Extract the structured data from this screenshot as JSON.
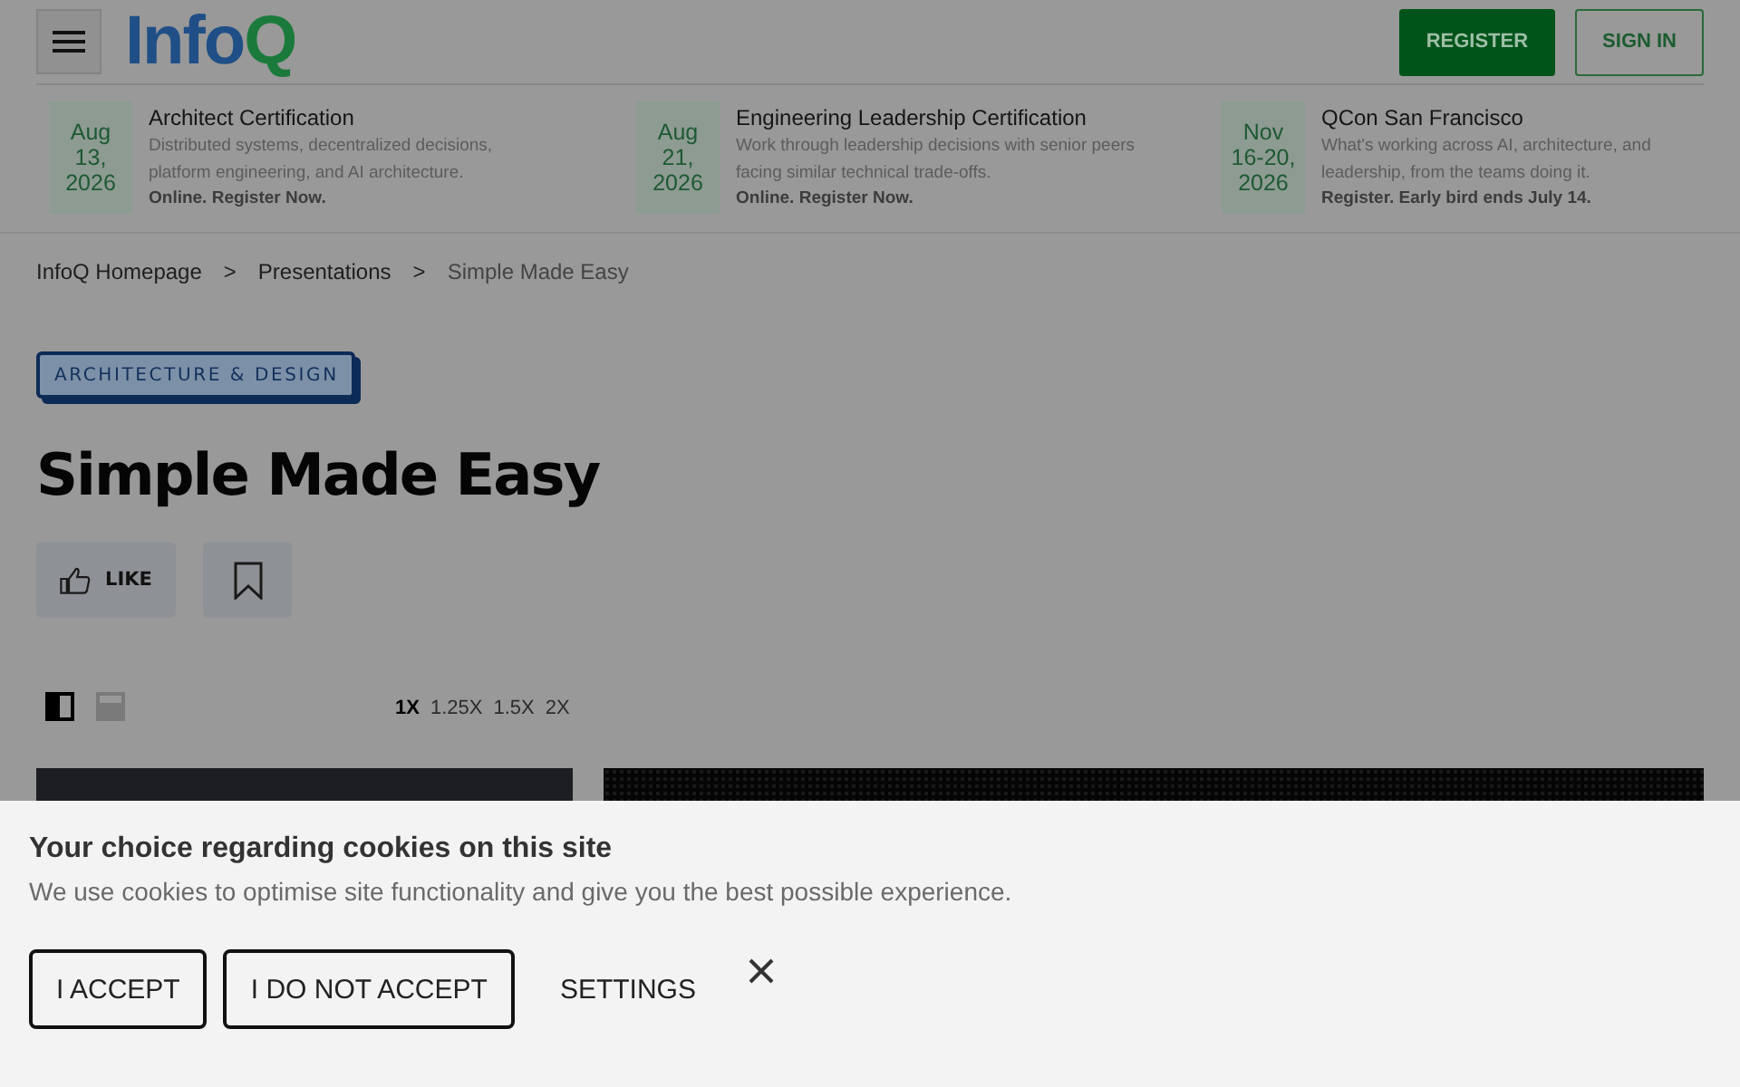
{
  "header": {
    "logo": [
      {
        "text": "Info",
        "color": "#1f4f86"
      },
      {
        "text": "Q",
        "color": "#1b7a3b"
      }
    ],
    "buttons": [
      {
        "label": "REGISTER",
        "kind": "primary"
      },
      {
        "label": "SIGN IN",
        "kind": "outline"
      }
    ]
  },
  "events": [
    {
      "date": [
        "Aug",
        "13,",
        "2026"
      ],
      "title": "Architect Certification",
      "description": "Distributed systems, decentralized decisions, platform engineering, and AI architecture.",
      "cta": "Online. Register Now."
    },
    {
      "date": [
        "Aug",
        "21,",
        "2026"
      ],
      "title": "Engineering Leadership Certification",
      "description": "Work through leadership decisions with senior peers facing similar technical trade-offs.",
      "cta": "Online. Register Now."
    },
    {
      "date": [
        "Nov",
        "16-20,",
        "2026"
      ],
      "title": "QCon San Francisco",
      "description": "What's working across AI, architecture, and leadership, from the teams doing it.",
      "cta": "Register. Early bird ends July 14."
    }
  ],
  "breadcrumb": [
    {
      "label": "InfoQ Homepage",
      "kind": "link"
    },
    {
      "label": ">",
      "kind": "separator"
    },
    {
      "label": "Presentations",
      "kind": "link"
    },
    {
      "label": ">",
      "kind": "separator"
    },
    {
      "label": "Simple Made Easy",
      "kind": "current"
    }
  ],
  "topic_tag": "ARCHITECTURE & DESIGN",
  "title": "Simple Made Easy",
  "actions": [
    {
      "kind": "like",
      "label": "LIKE"
    },
    {
      "kind": "bookmark"
    }
  ],
  "player": {
    "view_modes": [
      {
        "kind": "columns",
        "selected": true
      },
      {
        "kind": "rows",
        "selected": false
      }
    ],
    "speeds": [
      {
        "label": "1X",
        "selected": true
      },
      {
        "label": "1.25X",
        "selected": false
      },
      {
        "label": "1.5X",
        "selected": false
      },
      {
        "label": "2X",
        "selected": false
      }
    ]
  },
  "cookie_banner": {
    "title": "Your choice regarding cookies on this site",
    "text": "We use cookies to optimise site functionality and give you the best possible experience.",
    "buttons": [
      {
        "label": "I ACCEPT",
        "kind": "outlined"
      },
      {
        "label": "I DO NOT ACCEPT",
        "kind": "outlined"
      },
      {
        "label": "SETTINGS",
        "kind": "text"
      }
    ]
  }
}
